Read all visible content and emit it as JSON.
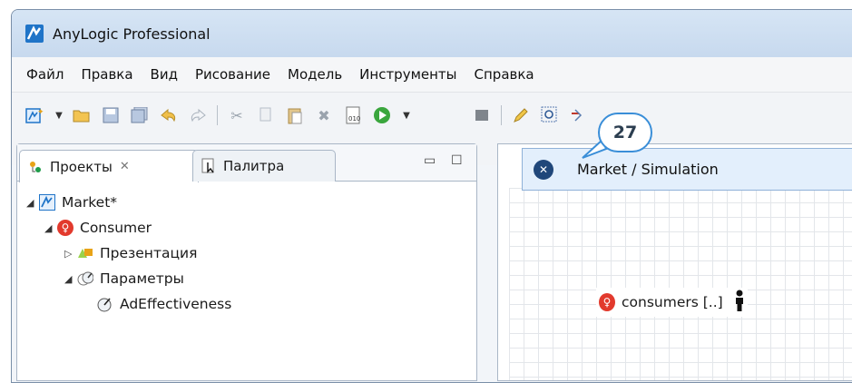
{
  "window": {
    "title": "AnyLogic Professional"
  },
  "menu": [
    "Файл",
    "Правка",
    "Вид",
    "Рисование",
    "Модель",
    "Инструменты",
    "Справка"
  ],
  "toolbar": {
    "icons": [
      "new-model-icon",
      "dropdown-arrow-icon",
      "open-folder-icon",
      "save-icon",
      "save-all-icon",
      "undo-icon",
      "redo-icon",
      "cut-icon",
      "copy-icon",
      "paste-icon",
      "delete-icon",
      "build-icon",
      "run-icon",
      "dropdown-arrow-icon",
      "stop-icon",
      "pencil-icon",
      "zoom-icon",
      "search-icon"
    ]
  },
  "left_panel": {
    "tabs": [
      {
        "label": "Проекты",
        "active": true
      },
      {
        "label": "Палитра",
        "active": false
      }
    ],
    "tree": [
      {
        "label": "Market*",
        "level": 0,
        "icon": "anylogic-model-icon"
      },
      {
        "label": "Consumer",
        "level": 1,
        "icon": "agent-icon"
      },
      {
        "label": "Презентация",
        "level": 2,
        "icon": "presentation-icon"
      },
      {
        "label": "Параметры",
        "level": 2,
        "icon": "parameters-icon"
      },
      {
        "label": "AdEffectiveness",
        "level": 3,
        "icon": "parameter-icon"
      }
    ]
  },
  "canvas": {
    "agent_label": "consumers [..]"
  },
  "run_popup": {
    "item": "Market / Simulation"
  },
  "callout": {
    "number": "27"
  },
  "colors": {
    "accent": "#1f74c8",
    "agent_red": "#e23a2d",
    "callout_border": "#3a8ed8"
  }
}
